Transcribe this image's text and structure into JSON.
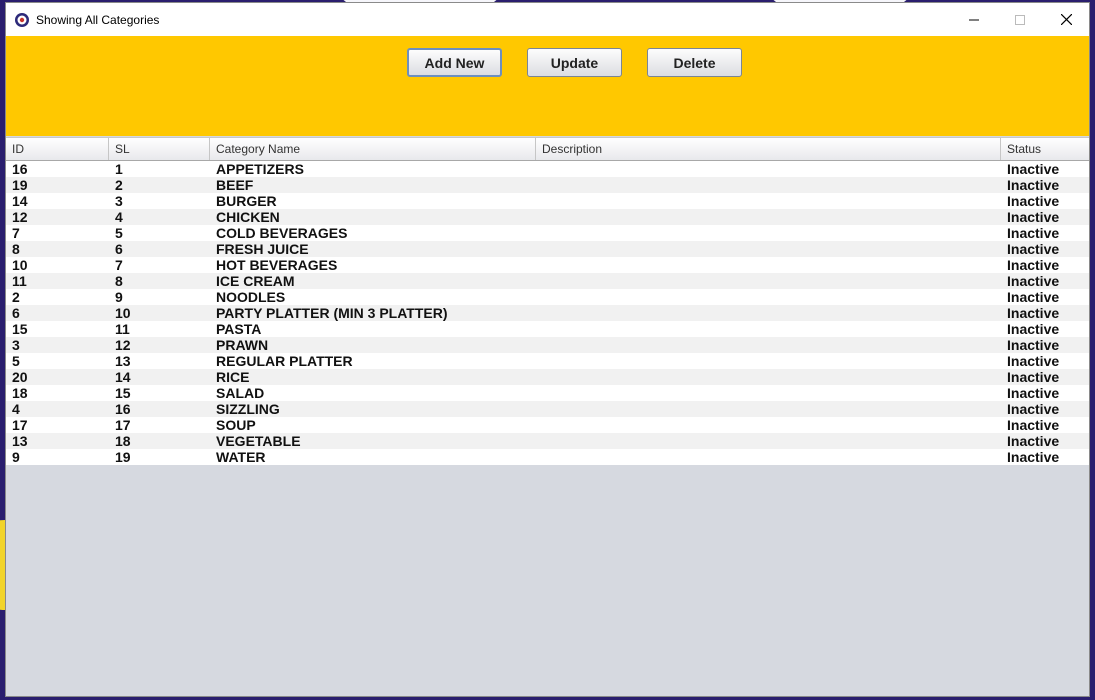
{
  "window": {
    "title": "Showing All Categories"
  },
  "toolbar": {
    "add_label": "Add New",
    "update_label": "Update",
    "delete_label": "Delete"
  },
  "table": {
    "headers": [
      "ID",
      "SL",
      "Category Name",
      "Description",
      "Status"
    ],
    "rows": [
      {
        "id": "16",
        "sl": "1",
        "name": "APPETIZERS",
        "desc": "",
        "status": "Inactive"
      },
      {
        "id": "19",
        "sl": "2",
        "name": "BEEF",
        "desc": "",
        "status": "Inactive"
      },
      {
        "id": "14",
        "sl": "3",
        "name": "BURGER",
        "desc": "",
        "status": "Inactive"
      },
      {
        "id": "12",
        "sl": "4",
        "name": "CHICKEN",
        "desc": "",
        "status": "Inactive"
      },
      {
        "id": "7",
        "sl": "5",
        "name": "COLD BEVERAGES",
        "desc": "",
        "status": "Inactive"
      },
      {
        "id": "8",
        "sl": "6",
        "name": "FRESH JUICE",
        "desc": "",
        "status": "Inactive"
      },
      {
        "id": "10",
        "sl": "7",
        "name": "HOT BEVERAGES",
        "desc": "",
        "status": "Inactive"
      },
      {
        "id": "11",
        "sl": "8",
        "name": "ICE CREAM",
        "desc": "",
        "status": "Inactive"
      },
      {
        "id": "2",
        "sl": "9",
        "name": "NOODLES",
        "desc": "",
        "status": "Inactive"
      },
      {
        "id": "6",
        "sl": "10",
        "name": "PARTY PLATTER (MIN 3 PLATTER)",
        "desc": "",
        "status": "Inactive"
      },
      {
        "id": "15",
        "sl": "11",
        "name": "PASTA",
        "desc": "",
        "status": "Inactive"
      },
      {
        "id": "3",
        "sl": "12",
        "name": "PRAWN",
        "desc": "",
        "status": "Inactive"
      },
      {
        "id": "5",
        "sl": "13",
        "name": "REGULAR PLATTER",
        "desc": "",
        "status": "Inactive"
      },
      {
        "id": "20",
        "sl": "14",
        "name": "RICE",
        "desc": "",
        "status": "Inactive"
      },
      {
        "id": "18",
        "sl": "15",
        "name": "SALAD",
        "desc": "",
        "status": "Inactive"
      },
      {
        "id": "4",
        "sl": "16",
        "name": "SIZZLING",
        "desc": "",
        "status": "Inactive"
      },
      {
        "id": "17",
        "sl": "17",
        "name": "SOUP",
        "desc": "",
        "status": "Inactive"
      },
      {
        "id": "13",
        "sl": "18",
        "name": "VEGETABLE",
        "desc": "",
        "status": "Inactive"
      },
      {
        "id": "9",
        "sl": "19",
        "name": "WATER",
        "desc": "",
        "status": "Inactive"
      }
    ]
  },
  "colors": {
    "toolbar_bg": "#ffc800",
    "empty_area": "#d6d9e0"
  },
  "icons": {
    "app": "gear-badge-icon",
    "minimize": "minimize-icon",
    "maximize": "maximize-icon",
    "close": "close-icon"
  }
}
